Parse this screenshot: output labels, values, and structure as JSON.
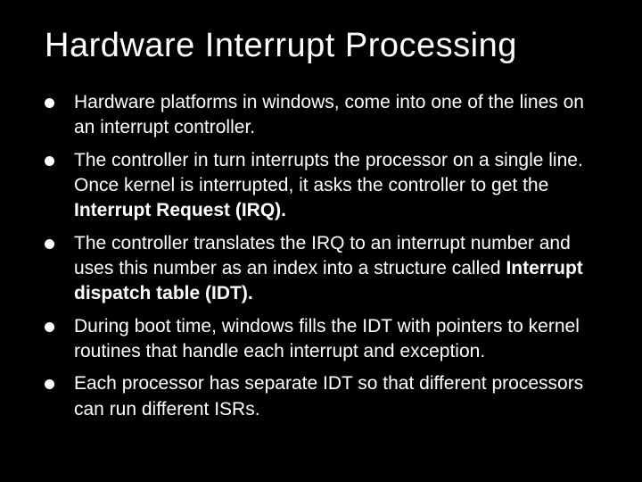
{
  "title": "Hardware Interrupt Processing",
  "bullets": [
    {
      "html": "Hardware platforms in windows, come into one of the lines on an interrupt controller."
    },
    {
      "html": "The controller in turn interrupts the processor on a single line. Once kernel is interrupted, it asks the controller to get the <b>Interrupt Request (IRQ).</b>"
    },
    {
      "html": "The controller translates the IRQ to an interrupt number and uses this number as an index into a structure called <b>Interrupt dispatch table (IDT).</b>"
    },
    {
      "html": "During boot time, windows fills the IDT with pointers to kernel routines that handle each interrupt and exception."
    },
    {
      "html": "Each processor has separate IDT so that different processors can run different ISRs."
    }
  ]
}
